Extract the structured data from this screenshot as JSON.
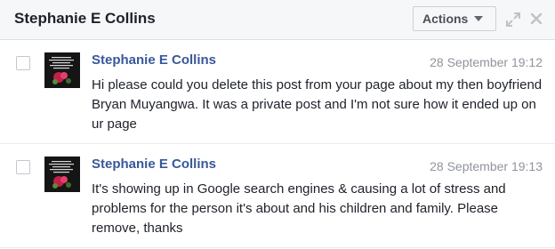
{
  "conversation": {
    "title": "Stephanie E Collins",
    "actions_label": "Actions"
  },
  "icons": {
    "expand": "expand-arrows-icon",
    "close": "close-x-icon",
    "dropdown": "caret-down-icon"
  },
  "messages": [
    {
      "sender": "Stephanie E Collins",
      "timestamp": "28 September 19:12",
      "text": "Hi please could you delete this post from your page about my then boyfriend Bryan Muyangwa. It was a private post and I'm not sure how it ended up on ur page"
    },
    {
      "sender": "Stephanie E Collins",
      "timestamp": "28 September 19:13",
      "text": "It's showing up in Google search engines & causing a lot of stress and problems for the person it's about and his children and family. Please remove, thanks"
    }
  ],
  "colors": {
    "sender_link": "#385898",
    "timestamp": "#90949c",
    "header_bg": "#f6f7f9"
  }
}
